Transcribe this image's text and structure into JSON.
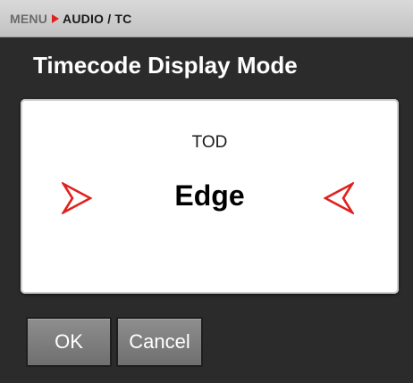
{
  "breadcrumb": {
    "root": "MENU",
    "current": "AUDIO / TC"
  },
  "title": "Timecode Display Mode",
  "selector": {
    "previous_option": "TOD",
    "current_value": "Edge",
    "left_arrow_icon": "chevron-right-icon",
    "right_arrow_icon": "chevron-left-icon",
    "arrow_color": "#e0211f"
  },
  "buttons": {
    "ok_label": "OK",
    "cancel_label": "Cancel"
  }
}
